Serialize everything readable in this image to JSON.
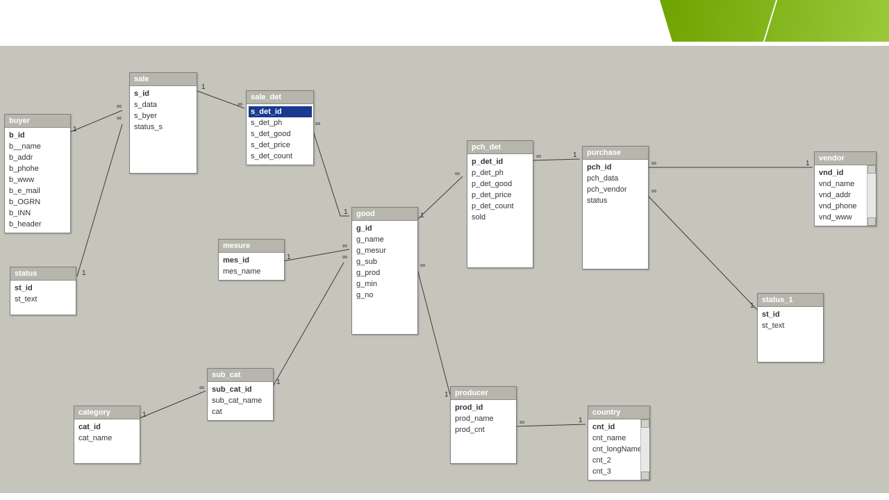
{
  "cardinality": {
    "one": "1",
    "many": "∞"
  },
  "tables": {
    "buyer": {
      "title": "buyer",
      "pk": "b_id",
      "cols": [
        "b__name",
        "b_addr",
        "b_phohe",
        "b_www",
        "b_e_mail",
        "b_OGRN",
        "b_INN",
        "b_header"
      ]
    },
    "sale": {
      "title": "sale",
      "pk": "s_id",
      "cols": [
        "s_data",
        "s_byer",
        "status_s"
      ]
    },
    "sale_det": {
      "title": "sale_det",
      "pk": "s_det_id",
      "cols": [
        "s_det_ph",
        "s_det_good",
        "s_det_price",
        "s_det_count"
      ]
    },
    "status": {
      "title": "status",
      "pk": "st_id",
      "cols": [
        "st_text"
      ]
    },
    "mesure": {
      "title": "mesure",
      "pk": "mes_id",
      "cols": [
        "mes_name"
      ]
    },
    "good": {
      "title": "good",
      "pk": "g_id",
      "cols": [
        "g_name",
        "g_mesur",
        "g_sub",
        "g_prod",
        "g_min",
        "g_no"
      ]
    },
    "pch_det": {
      "title": "pch_det",
      "pk": "p_det_id",
      "cols": [
        "p_det_ph",
        "p_det_good",
        "p_det_price",
        "p_det_count",
        "sold"
      ]
    },
    "purchase": {
      "title": "purchase",
      "pk": "pch_id",
      "cols": [
        "pch_data",
        "pch_vendor",
        "status"
      ]
    },
    "vendor": {
      "title": "vendor",
      "pk": "vnd_id",
      "cols": [
        "vnd_name",
        "vnd_addr",
        "vnd_phone",
        "vnd_www"
      ]
    },
    "status_1": {
      "title": "status_1",
      "pk": "st_id",
      "cols": [
        "st_text"
      ]
    },
    "sub_cat": {
      "title": "sub_cat",
      "pk": "sub_cat_id",
      "cols": [
        "sub_cat_name",
        "cat"
      ]
    },
    "category": {
      "title": "category",
      "pk": "cat_id",
      "cols": [
        "cat_name"
      ]
    },
    "producer": {
      "title": "producer",
      "pk": "prod_id",
      "cols": [
        "prod_name",
        "prod_cnt"
      ]
    },
    "country": {
      "title": "country",
      "pk": "cnt_id",
      "cols": [
        "cnt_name",
        "cnt_longName",
        "cnt_2",
        "cnt_3"
      ]
    }
  }
}
